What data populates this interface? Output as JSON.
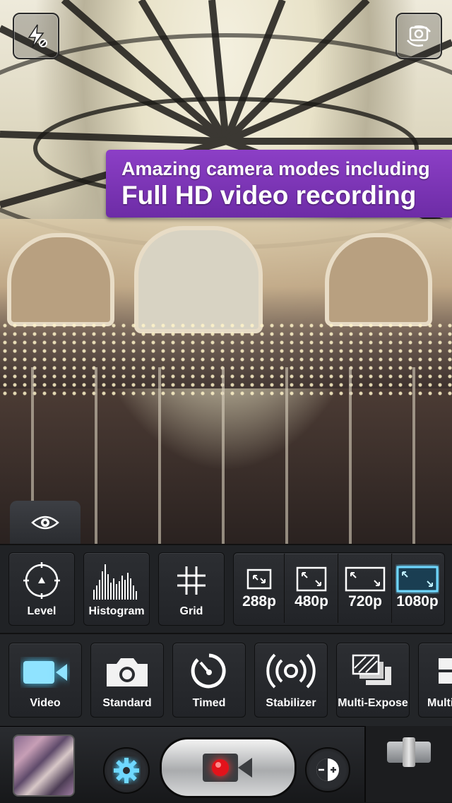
{
  "banner": {
    "line1": "Amazing camera modes including",
    "line2": "Full HD video recording"
  },
  "toolbar": {
    "tools": [
      {
        "label": "Level",
        "icon": "level-icon"
      },
      {
        "label": "Histogram",
        "icon": "histogram-icon"
      },
      {
        "label": "Grid",
        "icon": "grid-icon"
      }
    ],
    "resolutions": [
      {
        "label": "288p"
      },
      {
        "label": "480p"
      },
      {
        "label": "720p"
      },
      {
        "label": "1080p",
        "selected": true
      }
    ]
  },
  "modes": [
    {
      "label": "Video",
      "icon": "video-camera-icon",
      "selected": true
    },
    {
      "label": "Standard",
      "icon": "camera-icon"
    },
    {
      "label": "Timed",
      "icon": "timer-icon"
    },
    {
      "label": "Stabilizer",
      "icon": "stabilizer-icon"
    },
    {
      "label": "Multi-Expose",
      "icon": "multi-expose-icon"
    },
    {
      "label": "Multi",
      "icon": "multi-shot-icon"
    }
  ],
  "colors": {
    "accent": "#6fd8ff",
    "banner": "#7a33b5",
    "record": "#e3131b"
  }
}
